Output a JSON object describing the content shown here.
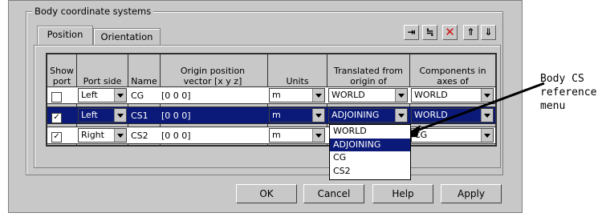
{
  "group_title": "Body coordinate systems",
  "tabs": [
    {
      "label": "Position",
      "active": true
    },
    {
      "label": "Orientation",
      "active": false
    }
  ],
  "toolbar_icons": [
    "insert-row-icon",
    "insert-below-icon",
    "delete-icon",
    "move-up-icon",
    "move-down-icon"
  ],
  "headers": {
    "show_port": "Show port",
    "port_side": "Port side",
    "name": "Name",
    "origin": "Origin position vector [x y z]",
    "units": "Units",
    "translated": "Translated from origin of",
    "components": "Components in axes of"
  },
  "rows": [
    {
      "show": false,
      "side": "Left",
      "name": "CG",
      "origin": "[0 0 0]",
      "units": "m",
      "translated": "WORLD",
      "components": "WORLD",
      "selected": false
    },
    {
      "show": true,
      "side": "Left",
      "name": "CS1",
      "origin": "[0 0 0]",
      "units": "m",
      "translated": "ADJOINING",
      "components": "WORLD",
      "selected": true
    },
    {
      "show": true,
      "side": "Right",
      "name": "CS2",
      "origin": "[0 0 0]",
      "units": "m",
      "translated": "",
      "components": "CG",
      "selected": false
    }
  ],
  "dropdown_options": [
    "WORLD",
    "ADJOINING",
    "CG",
    "CS2"
  ],
  "dropdown_selected": "ADJOINING",
  "buttons": {
    "ok": "OK",
    "cancel": "Cancel",
    "help": "Help",
    "apply": "Apply"
  },
  "callout": {
    "line1": "Body CS",
    "line2": "reference",
    "line3": "menu"
  },
  "colors": {
    "dialog": "#c8c8c8",
    "selection": "#0b1a78",
    "delete_icon": "#d01010"
  }
}
